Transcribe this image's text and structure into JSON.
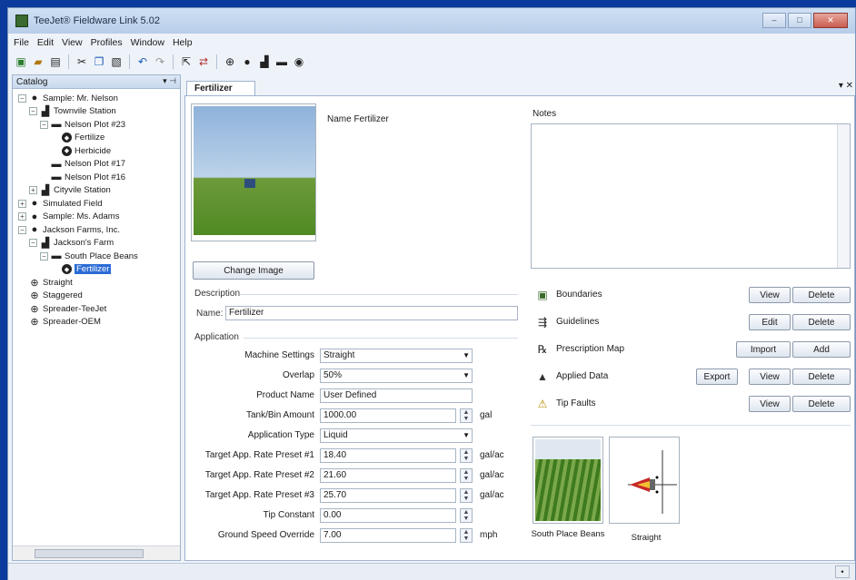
{
  "window": {
    "title": "TeeJet® Fieldware Link 5.02",
    "buttons": {
      "minimize": "‒",
      "maximize": "□",
      "close": "✕"
    }
  },
  "menu": [
    "File",
    "Edit",
    "View",
    "Profiles",
    "Window",
    "Help"
  ],
  "toolbar": {
    "icons": [
      "new-icon",
      "open-icon",
      "save-icon",
      "cut-icon",
      "copy-icon",
      "paste-icon",
      "undo-icon",
      "redo-icon",
      "export-icon",
      "import-icon",
      "machine-icon",
      "customer-icon",
      "farm-icon",
      "field-icon",
      "task-icon"
    ]
  },
  "catalog": {
    "title": "Catalog",
    "pin": "▾ ⊣"
  },
  "tree": [
    {
      "label": "Sample: Mr. Nelson",
      "exp": "−",
      "icon": "customer",
      "level": 0
    },
    {
      "label": "Townvile Station",
      "exp": "−",
      "icon": "farm",
      "level": 1
    },
    {
      "label": "Nelson Plot #23",
      "exp": "−",
      "icon": "field",
      "level": 2
    },
    {
      "label": "Fertilize",
      "exp": "",
      "icon": "task",
      "level": 3
    },
    {
      "label": "Herbicide",
      "exp": "",
      "icon": "task",
      "level": 3
    },
    {
      "label": "Nelson Plot #17",
      "exp": "",
      "icon": "field",
      "level": 2
    },
    {
      "label": "Nelson Plot #16",
      "exp": "",
      "icon": "field",
      "level": 2
    },
    {
      "label": "Cityvile Station",
      "exp": "+",
      "icon": "farm",
      "level": 1
    },
    {
      "label": "Simulated Field",
      "exp": "+",
      "icon": "customer",
      "level": 0
    },
    {
      "label": "Sample: Ms. Adams",
      "exp": "+",
      "icon": "customer",
      "level": 0
    },
    {
      "label": "Jackson Farms, Inc.",
      "exp": "−",
      "icon": "customer",
      "level": 0
    },
    {
      "label": "Jackson's Farm",
      "exp": "−",
      "icon": "farm",
      "level": 1
    },
    {
      "label": "South Place Beans",
      "exp": "−",
      "icon": "field",
      "level": 2
    },
    {
      "label": "Fertilizer",
      "exp": "",
      "icon": "task",
      "level": 3,
      "selected": true
    },
    {
      "label": "Straight",
      "exp": "",
      "icon": "machine",
      "level": 0
    },
    {
      "label": "Staggered",
      "exp": "",
      "icon": "machine",
      "level": 0
    },
    {
      "label": "Spreader-TeeJet",
      "exp": "",
      "icon": "machine",
      "level": 0
    },
    {
      "label": "Spreader-OEM",
      "exp": "",
      "icon": "machine",
      "level": 0
    }
  ],
  "doc": {
    "tab": "Fertilizer",
    "tab_controls": "▾ ✕",
    "name_line": "Name Fertilizer",
    "change_image": "Change Image",
    "description_label": "Description",
    "name_label": "Name:",
    "name_value": "Fertilizer",
    "application_label": "Application",
    "fields": [
      {
        "label": "Machine Settings",
        "value": "Straight",
        "kind": "combo",
        "unit": ""
      },
      {
        "label": "Overlap",
        "value": "50%",
        "kind": "combo",
        "unit": ""
      },
      {
        "label": "Product Name",
        "value": "User Defined",
        "kind": "text",
        "unit": ""
      },
      {
        "label": "Tank/Bin Amount",
        "value": "1000.00",
        "kind": "spin",
        "unit": "gal"
      },
      {
        "label": "Application Type",
        "value": "Liquid",
        "kind": "combo",
        "unit": ""
      },
      {
        "label": "Target App. Rate Preset #1",
        "value": "18.40",
        "kind": "spin",
        "unit": "gal/ac"
      },
      {
        "label": "Target App. Rate Preset #2",
        "value": "21.60",
        "kind": "spin",
        "unit": "gal/ac"
      },
      {
        "label": "Target App. Rate Preset #3",
        "value": "25.70",
        "kind": "spin",
        "unit": "gal/ac"
      },
      {
        "label": "Tip Constant",
        "value": "0.00",
        "kind": "spin",
        "unit": ""
      },
      {
        "label": "Ground Speed Override",
        "value": "7.00",
        "kind": "spin",
        "unit": "mph"
      }
    ],
    "notes_label": "Notes",
    "actions": [
      {
        "label": "Boundaries",
        "icon": "boundary-icon",
        "buttons": [
          "View",
          "Delete"
        ]
      },
      {
        "label": "Guidelines",
        "icon": "guideline-icon",
        "buttons": [
          "Edit",
          "Delete"
        ]
      },
      {
        "label": "Prescription Map",
        "icon": "prescription-icon",
        "buttons": [
          "Import",
          "Add"
        ]
      },
      {
        "label": "Applied Data",
        "icon": "applied-data-icon",
        "buttons": [
          "Export",
          "View",
          "Delete"
        ]
      },
      {
        "label": "Tip Faults",
        "icon": "tip-fault-icon",
        "buttons": [
          "View",
          "Delete"
        ]
      }
    ],
    "thumbs": [
      {
        "caption": "South Place Beans"
      },
      {
        "caption": "Straight"
      }
    ]
  },
  "statusbar": {
    "cell": "•"
  }
}
